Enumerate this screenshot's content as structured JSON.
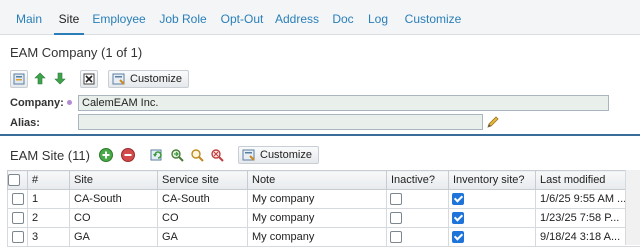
{
  "tabs": [
    "Main",
    "Site",
    "Employee",
    "Job Role",
    "Opt-Out",
    "Address",
    "Doc",
    "Log",
    "Customize"
  ],
  "active_tab": "Site",
  "company": {
    "title": "EAM Company (1 of 1)",
    "customize_label": "Customize",
    "company_label": "Company:",
    "company_value": "CalemEAM Inc.",
    "alias_label": "Alias:",
    "alias_value": ""
  },
  "site": {
    "title": "EAM Site (11)",
    "customize_label": "Customize",
    "columns": [
      "#",
      "Site",
      "Service site",
      "Note",
      "Inactive?",
      "Inventory site?",
      "Last modified"
    ],
    "rows": [
      {
        "num": "1",
        "site": "CA-South",
        "service": "CA-South",
        "note": "My company",
        "inactive": false,
        "inventory": true,
        "modified": "1/6/25 9:55 AM ..."
      },
      {
        "num": "2",
        "site": "CO",
        "service": "CO",
        "note": "My company",
        "inactive": false,
        "inventory": true,
        "modified": "1/23/25 7:58 P..."
      },
      {
        "num": "3",
        "site": "GA",
        "service": "GA",
        "note": "My company",
        "inactive": false,
        "inventory": true,
        "modified": "9/18/24 3:18 A..."
      }
    ]
  },
  "colors": {
    "accent": "#2a7fb8",
    "divider": "#3a6d9a",
    "checkbox_on": "#1e74d8"
  }
}
